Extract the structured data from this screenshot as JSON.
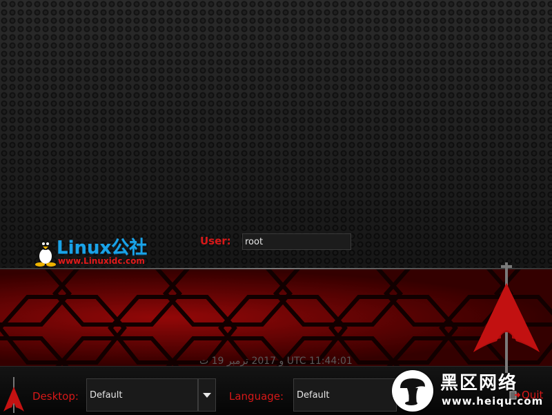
{
  "login": {
    "user_label": "User:",
    "user_value": "root"
  },
  "logo": {
    "brand": "Linux公社",
    "url": "www.Linuxidc.com"
  },
  "clock": {
    "text": "و 2017 ترمبر 19 ت UTC 11:44:01"
  },
  "desktop": {
    "label": "Desktop:",
    "value": "Default"
  },
  "language": {
    "label": "Language:",
    "value": "Default"
  },
  "quit": {
    "label": "Quit"
  },
  "watermark": {
    "title": "黑区网络",
    "url": "www.heiqu.com"
  },
  "colors": {
    "accent_red": "#d81818",
    "logo_blue": "#1aa3e8",
    "background": "#1b1b1b"
  },
  "icons": [
    "linux-penguin-icon",
    "arch-logo-icon",
    "dropdown-arrow-icon",
    "quit-icon",
    "mushroom-icon"
  ]
}
